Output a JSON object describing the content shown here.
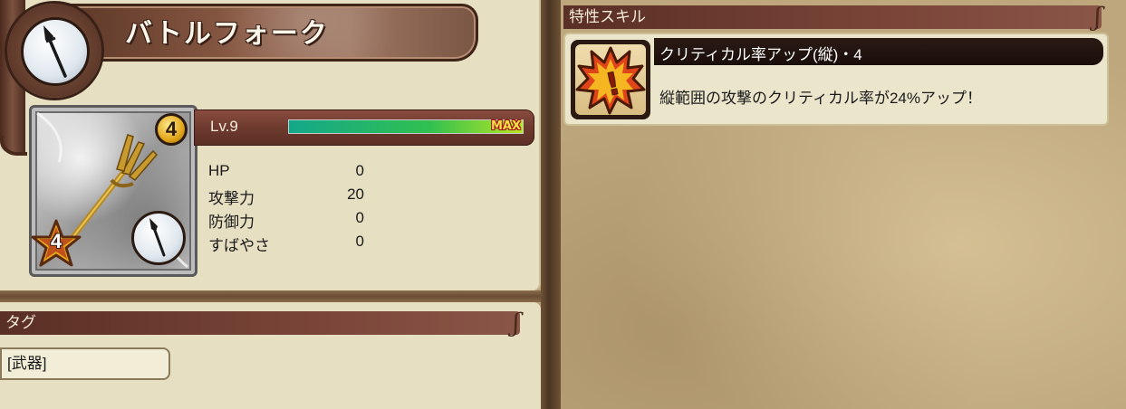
{
  "item": {
    "name": "バトルフォーク",
    "type_icon": "spear-icon",
    "rank": "4",
    "rarity": "4",
    "rarity_icon": "star-icon"
  },
  "level": {
    "label": "Lv.9",
    "exp_fraction": 1.0,
    "exp_label": "MAX"
  },
  "stats": [
    {
      "label": "HP",
      "value": "0"
    },
    {
      "label": "攻撃力",
      "value": "20"
    },
    {
      "label": "防御力",
      "value": "0"
    },
    {
      "label": "すばやさ",
      "value": "0"
    }
  ],
  "tags": {
    "header": "タグ",
    "items": [
      "[武器]"
    ]
  },
  "skills": {
    "header": "特性スキル",
    "items": [
      {
        "name": "クリティカル率アップ(縦)・4",
        "description": "縦範囲の攻撃のクリティカル率が24%アップ！",
        "icon": "critical-burst-icon"
      }
    ]
  },
  "colors": {
    "header_brown": "#7a4538",
    "panel_cream": "#e7dfc2",
    "exp_green": "#30c050",
    "gold": "#e0a51a"
  }
}
